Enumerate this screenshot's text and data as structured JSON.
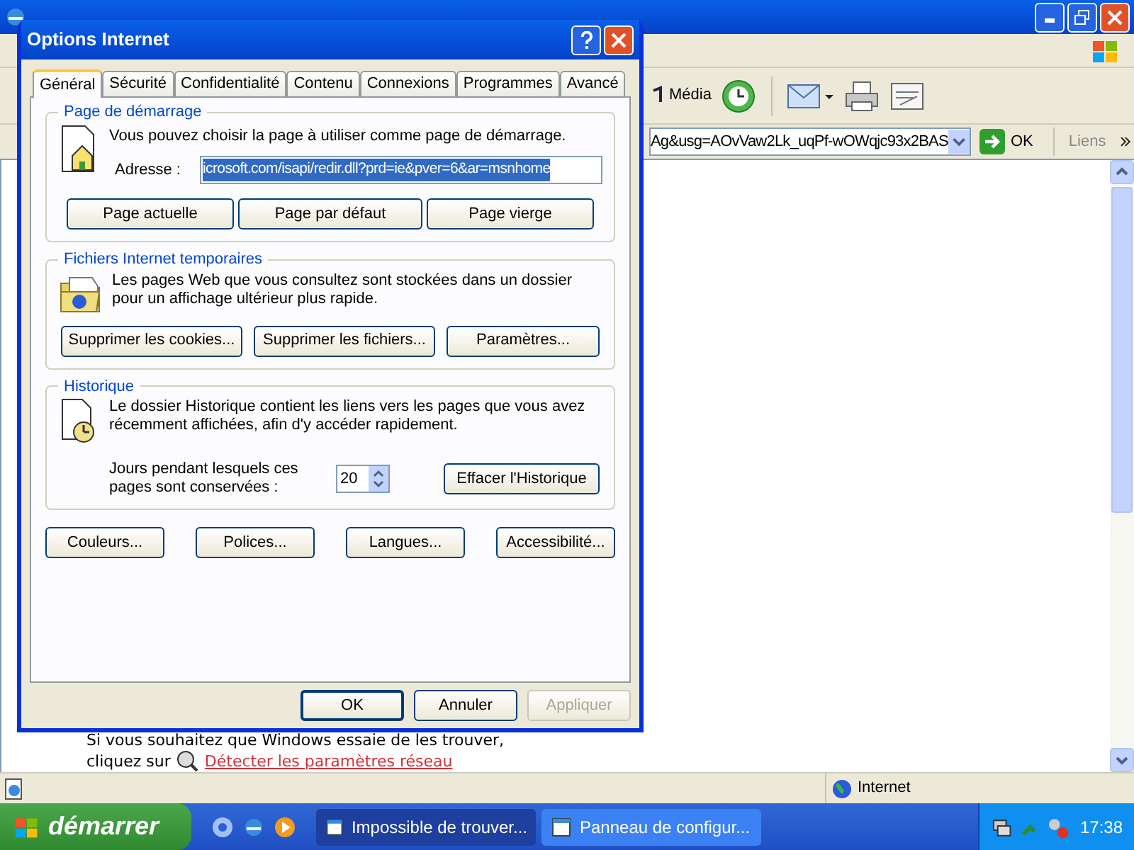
{
  "browser": {
    "toolbar": {
      "media_label": "Média"
    },
    "address_bar": {
      "value": "Ag&usg=AOvVaw2Lk_uqPf-wOWqjc93x2BAS",
      "go_label": "OK",
      "links_label": "Liens"
    },
    "page": {
      "line": "Si vous souhaitez que Windows essaie de les trouver,",
      "prefix": "cliquez sur",
      "link": "Détecter les paramètres réseau"
    },
    "status_bar": {
      "zone": "Internet"
    }
  },
  "dialog": {
    "title": "Options Internet",
    "tabs": [
      {
        "label": "Général",
        "selected": true
      },
      {
        "label": "Sécurité",
        "selected": false
      },
      {
        "label": "Confidentialité",
        "selected": false
      },
      {
        "label": "Contenu",
        "selected": false
      },
      {
        "label": "Connexions",
        "selected": false
      },
      {
        "label": "Programmes",
        "selected": false
      },
      {
        "label": "Avancé",
        "selected": false
      }
    ],
    "startup": {
      "legend": "Page de démarrage",
      "text": "Vous pouvez choisir la page à utiliser comme page de démarrage.",
      "address_label": "Adresse :",
      "address_value": "icrosoft.com/isapi/redir.dll?prd=ie&pver=6&ar=msnhome",
      "address_selected": true,
      "buttons": [
        "Page actuelle",
        "Page par défaut",
        "Page vierge"
      ]
    },
    "temp_files": {
      "legend": "Fichiers Internet temporaires",
      "text": "Les pages Web que vous consultez sont stockées dans un dossier pour un affichage ultérieur plus rapide.",
      "buttons": [
        "Supprimer les cookies...",
        "Supprimer les fichiers...",
        "Paramètres..."
      ]
    },
    "history": {
      "legend": "Historique",
      "text": "Le dossier Historique contient les liens vers les pages que vous avez récemment affichées, afin d'y accéder rapidement.",
      "days_label": "Jours pendant lesquels ces pages sont conservées :",
      "days": "20",
      "clear_button": "Effacer l'Historique"
    },
    "bottom_buttons": [
      "Couleurs...",
      "Polices...",
      "Langues...",
      "Accessibilité..."
    ],
    "footer_buttons": [
      {
        "label": "OK",
        "default": true,
        "disabled": false
      },
      {
        "label": "Annuler",
        "default": false,
        "disabled": false
      },
      {
        "label": "Appliquer",
        "default": false,
        "disabled": true
      }
    ]
  },
  "taskbar": {
    "start_label": "démarrer",
    "tasks": [
      {
        "label": "Impossible de trouver...",
        "selected": true
      },
      {
        "label": "Panneau de configur...",
        "selected": false
      }
    ],
    "clock": "17:38"
  }
}
